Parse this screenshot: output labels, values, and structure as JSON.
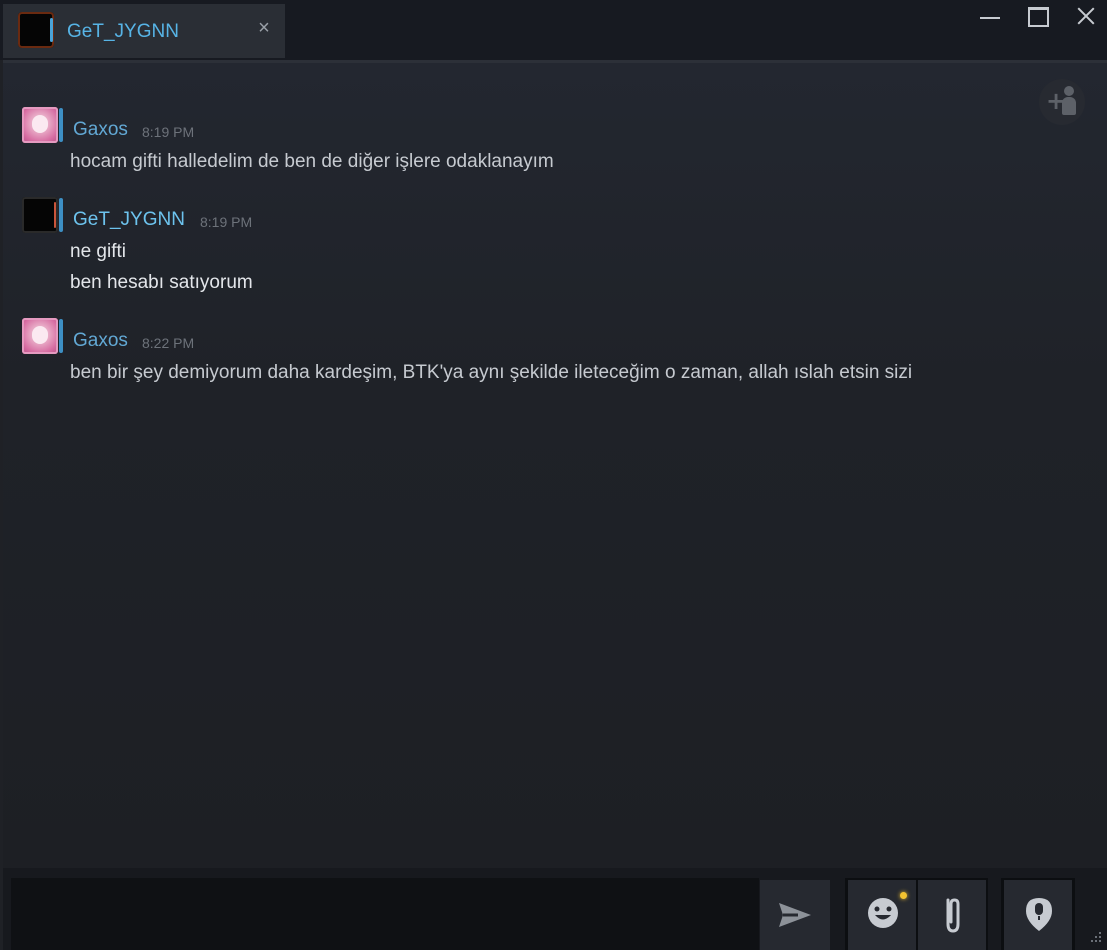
{
  "window": {
    "tab": {
      "title": "GeT_JYGNN",
      "close_glyph": "×"
    },
    "controls": [
      "minimize-icon",
      "maximize-icon",
      "close-icon"
    ]
  },
  "chat": {
    "add_friend": {
      "plus": "+",
      "icon": "add-person-icon"
    },
    "messages": [
      {
        "author": "Gaxos",
        "avatar": "pink-anime-avatar",
        "time": "8:19 PM",
        "lines": [
          "hocam gifti halledelim de ben de diğer işlere odaklanayım"
        ]
      },
      {
        "author": "GeT_JYGNN",
        "avatar": "black-avatar",
        "time": "8:19 PM",
        "lines": [
          "ne gifti",
          "ben hesabı satıyorum"
        ]
      },
      {
        "author": "Gaxos",
        "avatar": "pink-anime-avatar",
        "time": "8:22 PM",
        "lines": [
          "ben bir şey demiyorum daha kardeşim, BTK'ya aynı şekilde ileteceğim o zaman, allah ıslah etsin sizi"
        ]
      }
    ]
  },
  "composer": {
    "input_value": "",
    "icons": [
      "send-icon",
      "emoji-icon",
      "attachment-icon",
      "voice-icon"
    ],
    "notification_color": "#f2c230"
  },
  "colors": {
    "accent": "#57b4e6",
    "background": "#1f2126",
    "titlebar": "#171a21"
  }
}
